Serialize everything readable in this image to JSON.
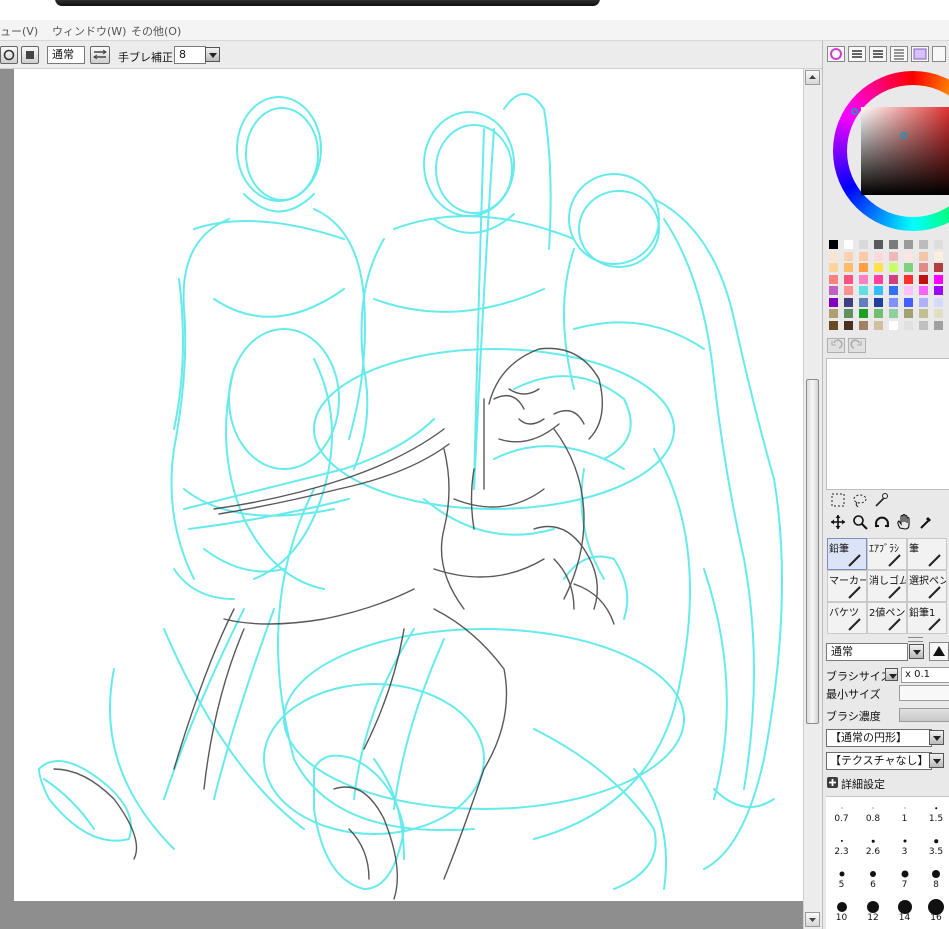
{
  "menu": {
    "view": "ュー(V)",
    "window": "ウィンドウ(W)",
    "other": "その他(O)"
  },
  "toolbar": {
    "blend_mode": "通常",
    "stabilizer_label": "手ブレ補正",
    "stabilizer_value": "8"
  },
  "colors": {
    "sketch_cyan": "#5fe9ea",
    "line_dark": "#3c3c3c",
    "canvas_bg": "#8e8e8e",
    "panel_bg": "#e9e9e9",
    "selected_tool": "#dbe3f7"
  },
  "palette": [
    "#000000",
    "#ffffff",
    "#d9d9d9",
    "#5a5a5a",
    "#7a7a7a",
    "#9a9a9a",
    "#bcbcbc",
    "#dddddd",
    "#ffe3cf",
    "#ffd0b0",
    "#ffc8a8",
    "#ffd8d8",
    "#f0b8b8",
    "#ffe4e4",
    "#f4c6a8",
    "#ffefe0",
    "#ffd39a",
    "#ffbd6a",
    "#ff9d40",
    "#ffe14a",
    "#c8ff6a",
    "#80d080",
    "#e08a8a",
    "#b04040",
    "#ff8080",
    "#ff5080",
    "#ff80c0",
    "#ff40a0",
    "#d04080",
    "#ff3030",
    "#c01010",
    "#ff00ff",
    "#c060c0",
    "#ff9090",
    "#60e0e0",
    "#30c0ff",
    "#3070ff",
    "#ffc0ff",
    "#ff60ff",
    "#a000ff",
    "#8000c0",
    "#404080",
    "#6080c0",
    "#2040a0",
    "#8090ff",
    "#4060ff",
    "#b0b0ff",
    "#d8d8ff",
    "#b0a070",
    "#609060",
    "#20a020",
    "#70c070",
    "#90d0a0",
    "#a0a070",
    "#c0c090",
    "#e0e0c0",
    "#6a4a20",
    "#4a3020",
    "#a08060",
    "#d0c0a0",
    "#ffffff",
    "#e0e0e0",
    "#c0c0c0",
    "#a0a0a0"
  ],
  "tools": {
    "brushes": [
      {
        "label": "鉛筆"
      },
      {
        "label": "ｴｱﾌﾞﾗｼ"
      },
      {
        "label": "筆"
      },
      {
        "label": "マーカー"
      },
      {
        "label": "消しゴム"
      },
      {
        "label": "選択ペン"
      },
      {
        "label": "バケツ"
      },
      {
        "label": "2値ペン"
      },
      {
        "label": "鉛筆1"
      }
    ]
  },
  "brush_settings": {
    "blend": "通常",
    "size_label": "ブラシサイズ",
    "size_multiplier": "x 0.1",
    "min_size_label": "最小サイズ",
    "density_label": "ブラシ濃度",
    "shape": "【通常の円形】",
    "texture": "【テクスチャなし】",
    "details": "詳細設定"
  },
  "brush_sizes": [
    "0.7",
    "0.8",
    "1",
    "1.5",
    "2.3",
    "2.6",
    "3",
    "3.5",
    "5",
    "6",
    "7",
    "8",
    "10",
    "12",
    "14",
    "16"
  ]
}
